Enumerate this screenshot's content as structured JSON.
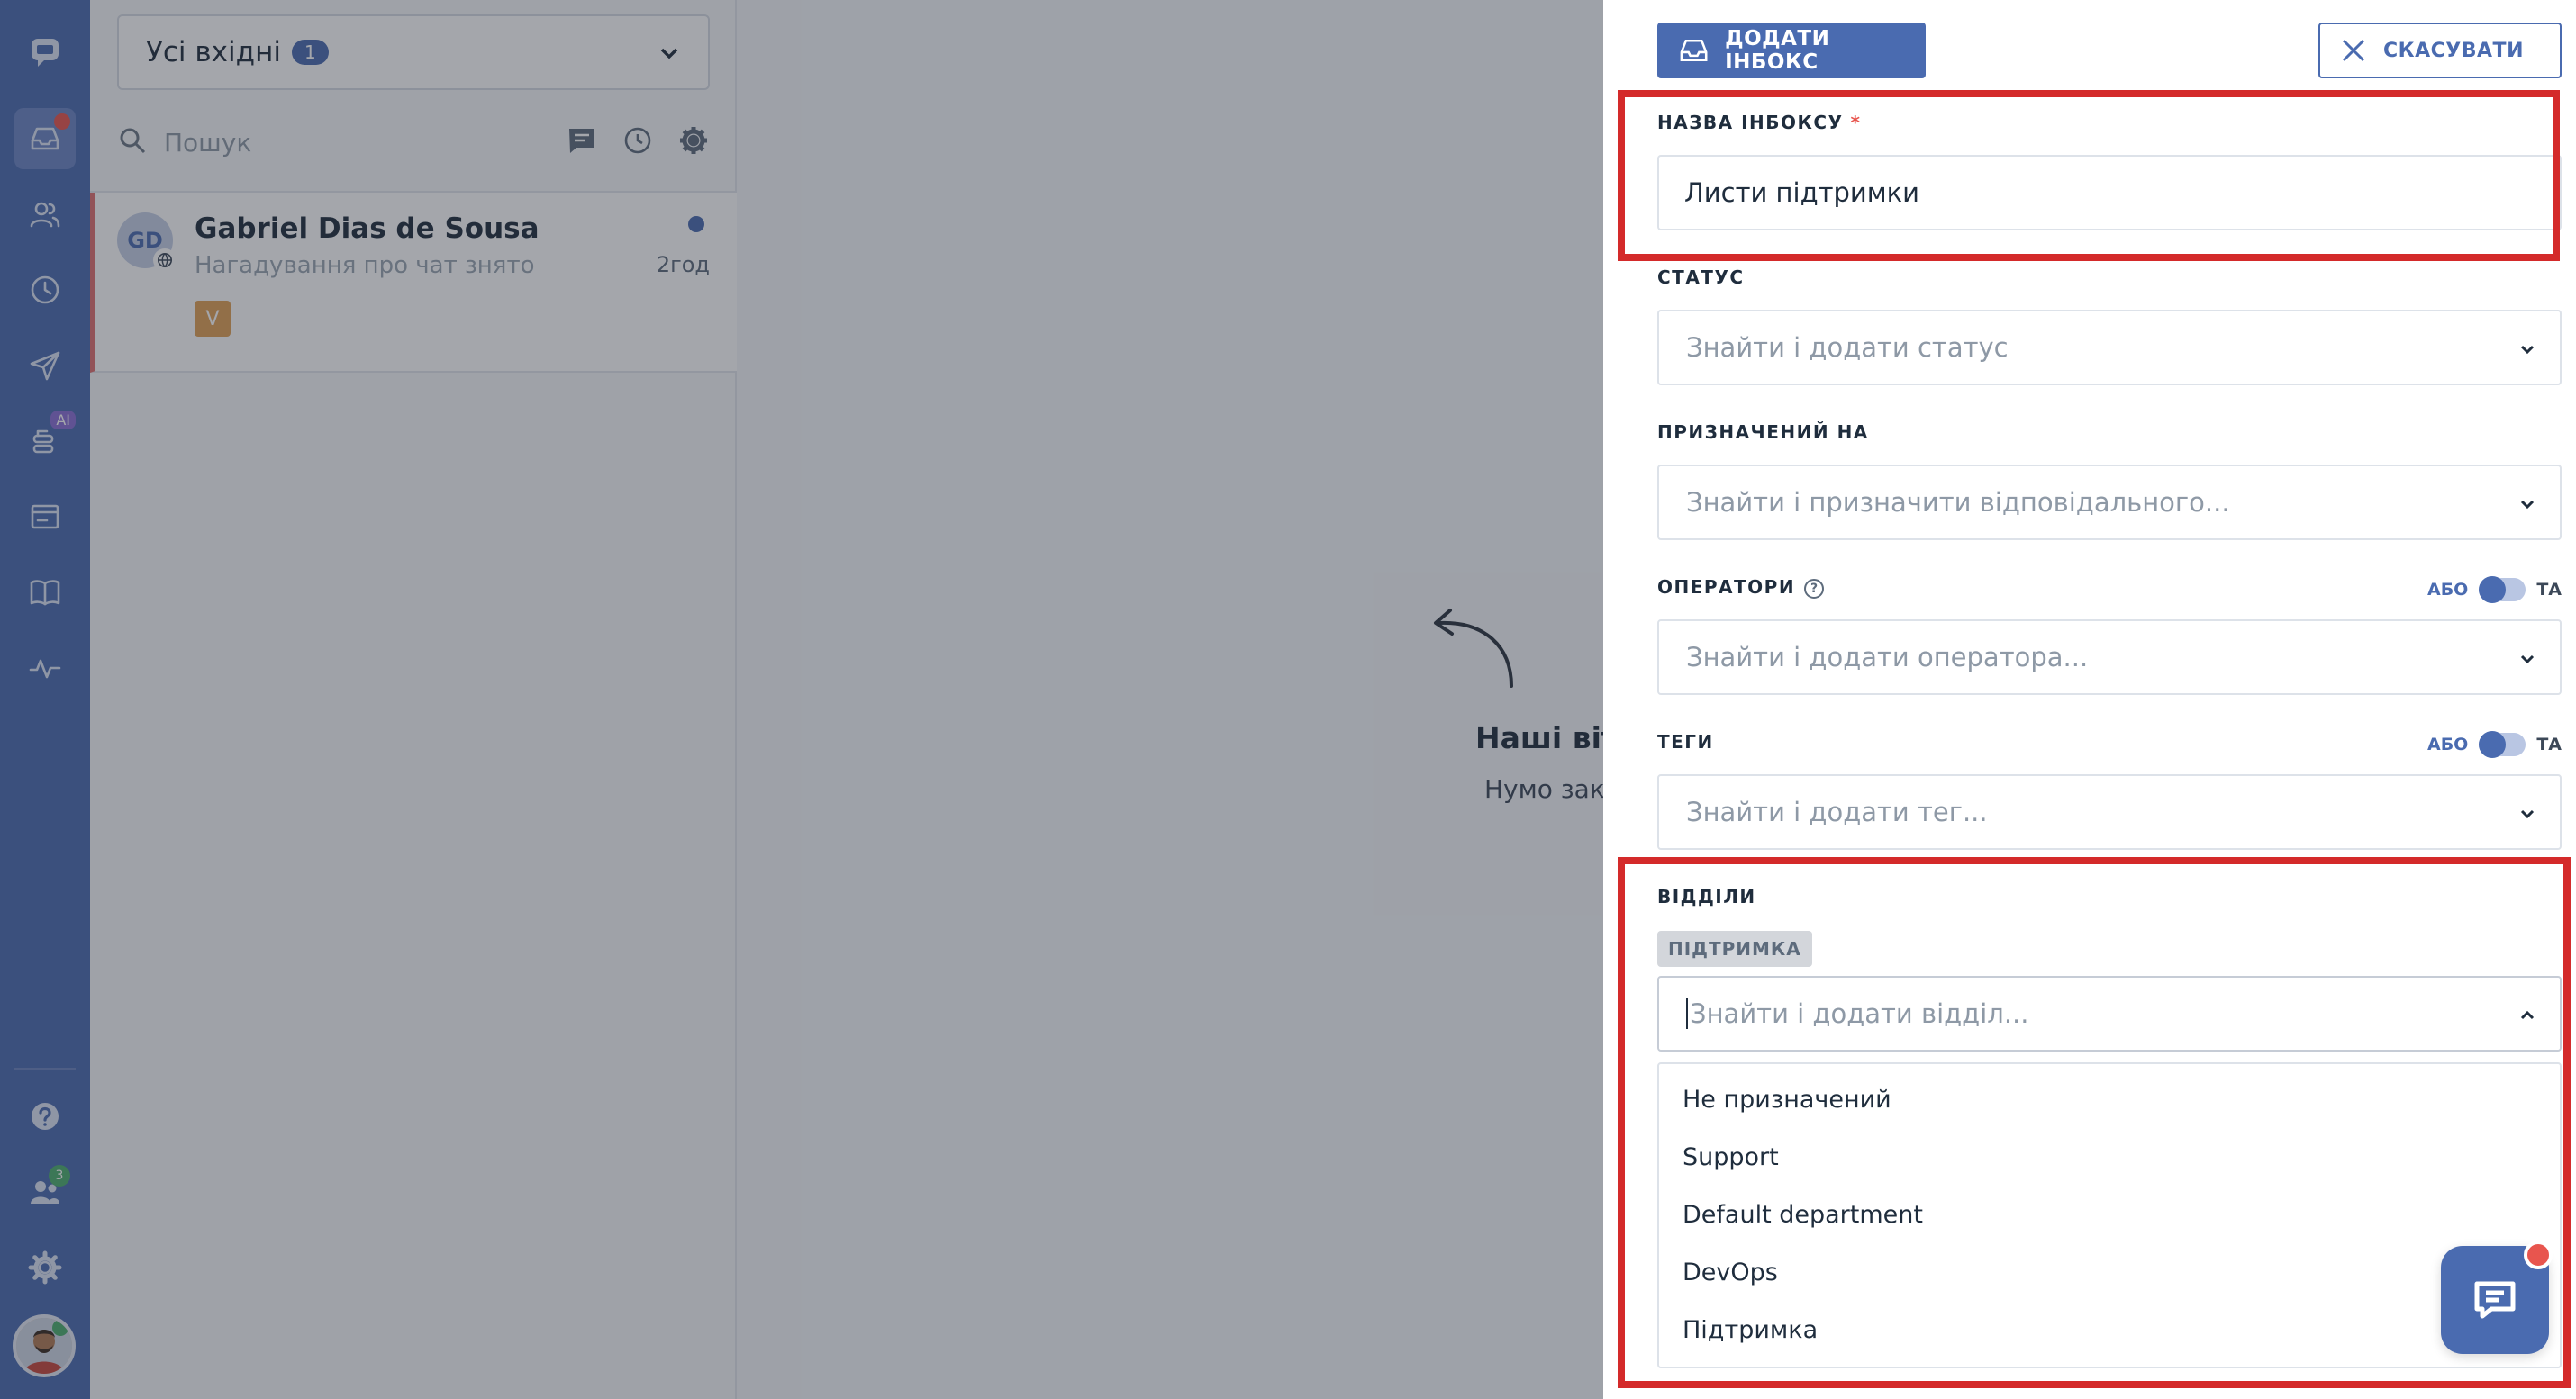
{
  "sidebar": {
    "icons": [
      "chat-logo-icon",
      "inbox-icon",
      "contacts-icon",
      "history-icon",
      "send-icon",
      "ai-bot-icon",
      "card-icon",
      "book-icon",
      "activity-icon",
      "help-icon",
      "team-icon",
      "settings-icon"
    ],
    "ai_badge": "AI",
    "team_count": "3"
  },
  "conversations": {
    "inbox_select": {
      "label": "Усі вхідні",
      "count": "1"
    },
    "search_placeholder": "Пошук",
    "items": [
      {
        "initials": "GD",
        "name": "Gabriel Dias de Sousa",
        "preview": "Нагадування про чат знято",
        "time": "2год",
        "tag": "V"
      }
    ]
  },
  "main": {
    "empty_title": "Наші віта",
    "empty_subtitle": "Нумо закр"
  },
  "drawer": {
    "add_button": "ДОДАТИ ІНБОКС",
    "cancel_button": "СКАСУВАТИ",
    "name_field": {
      "label": "НАЗВА ІНБОКСУ",
      "required_mark": "*",
      "value": "Листи підтримки"
    },
    "status_field": {
      "label": "СТАТУС",
      "placeholder": "Знайти і додати статус"
    },
    "assignee_field": {
      "label": "ПРИЗНАЧЕНИЙ НА",
      "placeholder": "Знайти і призначити відповідального..."
    },
    "operators_field": {
      "label": "ОПЕРАТОРИ",
      "help": "?",
      "toggle_or": "АБО",
      "toggle_and": "ТА",
      "placeholder": "Знайти і додати оператора..."
    },
    "tags_field": {
      "label": "ТЕГИ",
      "toggle_or": "АБО",
      "toggle_and": "ТА",
      "placeholder": "Знайти і додати тег..."
    },
    "departments_field": {
      "label": "ВІДДІЛИ",
      "chip": "ПІДТРИМКА",
      "placeholder": "Знайти і додати відділ...",
      "options": [
        "Не призначений",
        "Support",
        "Default department",
        "DevOps",
        "Підтримка"
      ]
    }
  },
  "colors": {
    "brand": "#4a6bb0",
    "highlight": "#d42a2a",
    "notification": "#e8554e"
  }
}
